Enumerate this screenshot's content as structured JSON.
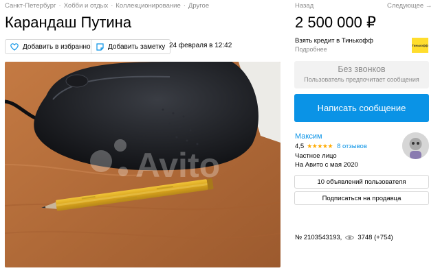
{
  "breadcrumb": [
    "Санкт-Петербург",
    "Хобби и отдых",
    "Коллекционирование",
    "Другое"
  ],
  "breadcrumb_separator": "·",
  "title": "Карандаш Путина",
  "actions": {
    "favorite_label": "Добавить в избранное",
    "note_label": "Добавить заметку",
    "date": "24 февраля в 12:42"
  },
  "nav": {
    "back": "Назад",
    "next": "Следующее →"
  },
  "price": "2 500 000 ₽",
  "credit": {
    "text": "Взять кредит в Тинькофф",
    "more": "Подробнее",
    "logo_text": "Тинькофф"
  },
  "no_calls": {
    "title": "Без звонков",
    "subtitle": "Пользователь предпочитает сообщения"
  },
  "write_button": "Написать сообщение",
  "seller": {
    "name": "Максим",
    "rating": "4,5",
    "stars": "★★★★★",
    "reviews": "8 отзывов",
    "type": "Частное лицо",
    "since": "На Авито с мая 2020"
  },
  "seller_buttons": {
    "ads": "10 объявлений пользователя",
    "subscribe": "Подписаться на продавца"
  },
  "meta": {
    "ad_number": "№ 2103543193,",
    "views": "3748 (+754)"
  },
  "photo": {
    "watermark": "Avito"
  },
  "colors": {
    "link": "#0a93e6",
    "star": "#ffaa00",
    "tinkoff": "#ffdd2d"
  }
}
